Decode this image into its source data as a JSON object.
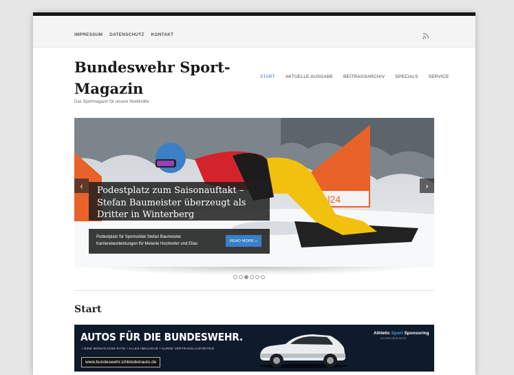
{
  "topbar": {
    "links": [
      "IMPRESSUM",
      "DATENSCHUTZ",
      "KONTAKT"
    ],
    "rss_icon": "rss-icon"
  },
  "site": {
    "title": "Bundeswehr Sport-Magazin",
    "tagline": "Das Sportmagazin für unsere Streitkräfte"
  },
  "nav": {
    "items": [
      "START",
      "AKTUELLE AUSGABE",
      "BEITRAGSARCHIV",
      "SPECIALS",
      "SERVICE"
    ],
    "active": "START"
  },
  "slider": {
    "title": "Podestplatz zum Saisonauftakt – Stefan Baumeister überzeugt als Dritter in Winterberg",
    "excerpt": "Podestplatz für Sportsoldat Stefan Baumeister. Karrierebestleistungen für Melanie Hochreiter und Elias",
    "read_more": "READ MORE »",
    "prev_icon": "‹",
    "next_icon": "›",
    "dots": 6,
    "active_dot": 3
  },
  "main": {
    "heading": "Start"
  },
  "banner": {
    "headline": "AUTOS FÜR DIE BUNDESWEHR.",
    "features": "• EINE MONATLICHE RATE  • ALLES INKLUSIVE  • KURZE VERTRAGSLAUFZEITEN",
    "url": "www.bundeswehr.ichbindeinauto.de",
    "sponsor_part1": "Athletic",
    "sponsor_part2": "Sport",
    "sponsor_part3": "Sponsoring",
    "sponsor_sub": "ICH BIN DEIN AUTO"
  },
  "colors": {
    "accent": "#2f73c2",
    "read_more_bg": "#3a80c9",
    "banner_bg": "#0f1a2b"
  }
}
